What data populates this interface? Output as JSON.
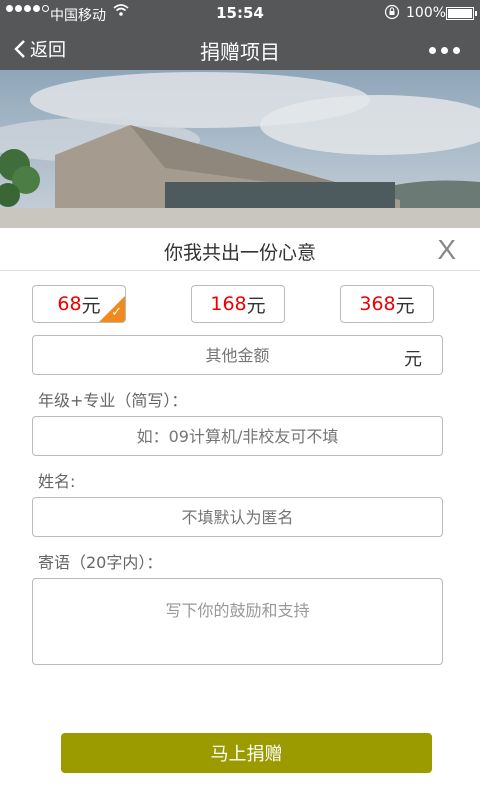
{
  "status_bar": {
    "carrier": "中国移动",
    "time": "15:54",
    "battery": "100%"
  },
  "nav": {
    "back_label": "返回",
    "title": "捐赠项目"
  },
  "modal": {
    "title": "你我共出一份心意",
    "close_label": "X",
    "amounts": [
      {
        "value": "68",
        "unit": " 元",
        "selected": true
      },
      {
        "value": "168",
        "unit": "元",
        "selected": false
      },
      {
        "value": "368",
        "unit": "元",
        "selected": false
      }
    ],
    "other_amount": {
      "placeholder": "其他金额",
      "unit": "元"
    },
    "grade_major": {
      "label": "年级+专业（简写）：",
      "placeholder": "如：09计算机/非校友可不填"
    },
    "name": {
      "label": "姓名:",
      "placeholder": "不填默认为匿名"
    },
    "message": {
      "label": "寄语（20字内）：",
      "placeholder": "写下你的鼓励和支持"
    },
    "submit_label": "马上捐赠"
  },
  "colors": {
    "bar": "#555758",
    "accent_red": "#e00000",
    "check_orange": "#f08a1c",
    "submit_olive": "#9b9b00"
  }
}
